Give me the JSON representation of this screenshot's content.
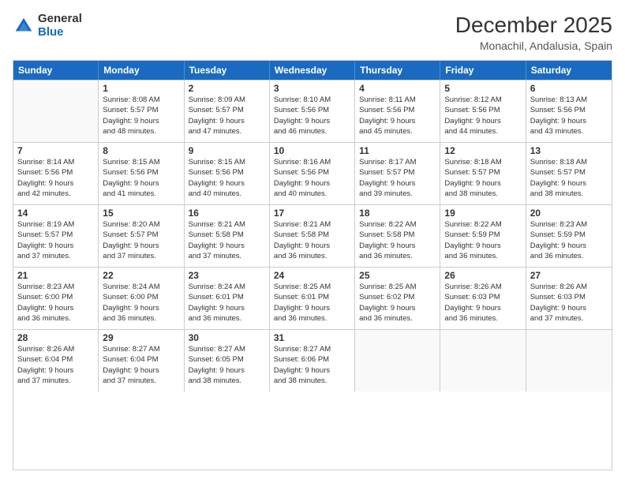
{
  "logo": {
    "general": "General",
    "blue": "Blue"
  },
  "title": {
    "month_year": "December 2025",
    "location": "Monachil, Andalusia, Spain"
  },
  "days_of_week": [
    "Sunday",
    "Monday",
    "Tuesday",
    "Wednesday",
    "Thursday",
    "Friday",
    "Saturday"
  ],
  "weeks": [
    [
      {
        "day": "",
        "info": ""
      },
      {
        "day": "1",
        "info": "Sunrise: 8:08 AM\nSunset: 5:57 PM\nDaylight: 9 hours\nand 48 minutes."
      },
      {
        "day": "2",
        "info": "Sunrise: 8:09 AM\nSunset: 5:57 PM\nDaylight: 9 hours\nand 47 minutes."
      },
      {
        "day": "3",
        "info": "Sunrise: 8:10 AM\nSunset: 5:56 PM\nDaylight: 9 hours\nand 46 minutes."
      },
      {
        "day": "4",
        "info": "Sunrise: 8:11 AM\nSunset: 5:56 PM\nDaylight: 9 hours\nand 45 minutes."
      },
      {
        "day": "5",
        "info": "Sunrise: 8:12 AM\nSunset: 5:56 PM\nDaylight: 9 hours\nand 44 minutes."
      },
      {
        "day": "6",
        "info": "Sunrise: 8:13 AM\nSunset: 5:56 PM\nDaylight: 9 hours\nand 43 minutes."
      }
    ],
    [
      {
        "day": "7",
        "info": "Sunrise: 8:14 AM\nSunset: 5:56 PM\nDaylight: 9 hours\nand 42 minutes."
      },
      {
        "day": "8",
        "info": "Sunrise: 8:15 AM\nSunset: 5:56 PM\nDaylight: 9 hours\nand 41 minutes."
      },
      {
        "day": "9",
        "info": "Sunrise: 8:15 AM\nSunset: 5:56 PM\nDaylight: 9 hours\nand 40 minutes."
      },
      {
        "day": "10",
        "info": "Sunrise: 8:16 AM\nSunset: 5:56 PM\nDaylight: 9 hours\nand 40 minutes."
      },
      {
        "day": "11",
        "info": "Sunrise: 8:17 AM\nSunset: 5:57 PM\nDaylight: 9 hours\nand 39 minutes."
      },
      {
        "day": "12",
        "info": "Sunrise: 8:18 AM\nSunset: 5:57 PM\nDaylight: 9 hours\nand 38 minutes."
      },
      {
        "day": "13",
        "info": "Sunrise: 8:18 AM\nSunset: 5:57 PM\nDaylight: 9 hours\nand 38 minutes."
      }
    ],
    [
      {
        "day": "14",
        "info": "Sunrise: 8:19 AM\nSunset: 5:57 PM\nDaylight: 9 hours\nand 37 minutes."
      },
      {
        "day": "15",
        "info": "Sunrise: 8:20 AM\nSunset: 5:57 PM\nDaylight: 9 hours\nand 37 minutes."
      },
      {
        "day": "16",
        "info": "Sunrise: 8:21 AM\nSunset: 5:58 PM\nDaylight: 9 hours\nand 37 minutes."
      },
      {
        "day": "17",
        "info": "Sunrise: 8:21 AM\nSunset: 5:58 PM\nDaylight: 9 hours\nand 36 minutes."
      },
      {
        "day": "18",
        "info": "Sunrise: 8:22 AM\nSunset: 5:58 PM\nDaylight: 9 hours\nand 36 minutes."
      },
      {
        "day": "19",
        "info": "Sunrise: 8:22 AM\nSunset: 5:59 PM\nDaylight: 9 hours\nand 36 minutes."
      },
      {
        "day": "20",
        "info": "Sunrise: 8:23 AM\nSunset: 5:59 PM\nDaylight: 9 hours\nand 36 minutes."
      }
    ],
    [
      {
        "day": "21",
        "info": "Sunrise: 8:23 AM\nSunset: 6:00 PM\nDaylight: 9 hours\nand 36 minutes."
      },
      {
        "day": "22",
        "info": "Sunrise: 8:24 AM\nSunset: 6:00 PM\nDaylight: 9 hours\nand 36 minutes."
      },
      {
        "day": "23",
        "info": "Sunrise: 8:24 AM\nSunset: 6:01 PM\nDaylight: 9 hours\nand 36 minutes."
      },
      {
        "day": "24",
        "info": "Sunrise: 8:25 AM\nSunset: 6:01 PM\nDaylight: 9 hours\nand 36 minutes."
      },
      {
        "day": "25",
        "info": "Sunrise: 8:25 AM\nSunset: 6:02 PM\nDaylight: 9 hours\nand 36 minutes."
      },
      {
        "day": "26",
        "info": "Sunrise: 8:26 AM\nSunset: 6:03 PM\nDaylight: 9 hours\nand 36 minutes."
      },
      {
        "day": "27",
        "info": "Sunrise: 8:26 AM\nSunset: 6:03 PM\nDaylight: 9 hours\nand 37 minutes."
      }
    ],
    [
      {
        "day": "28",
        "info": "Sunrise: 8:26 AM\nSunset: 6:04 PM\nDaylight: 9 hours\nand 37 minutes."
      },
      {
        "day": "29",
        "info": "Sunrise: 8:27 AM\nSunset: 6:04 PM\nDaylight: 9 hours\nand 37 minutes."
      },
      {
        "day": "30",
        "info": "Sunrise: 8:27 AM\nSunset: 6:05 PM\nDaylight: 9 hours\nand 38 minutes."
      },
      {
        "day": "31",
        "info": "Sunrise: 8:27 AM\nSunset: 6:06 PM\nDaylight: 9 hours\nand 38 minutes."
      },
      {
        "day": "",
        "info": ""
      },
      {
        "day": "",
        "info": ""
      },
      {
        "day": "",
        "info": ""
      }
    ]
  ]
}
